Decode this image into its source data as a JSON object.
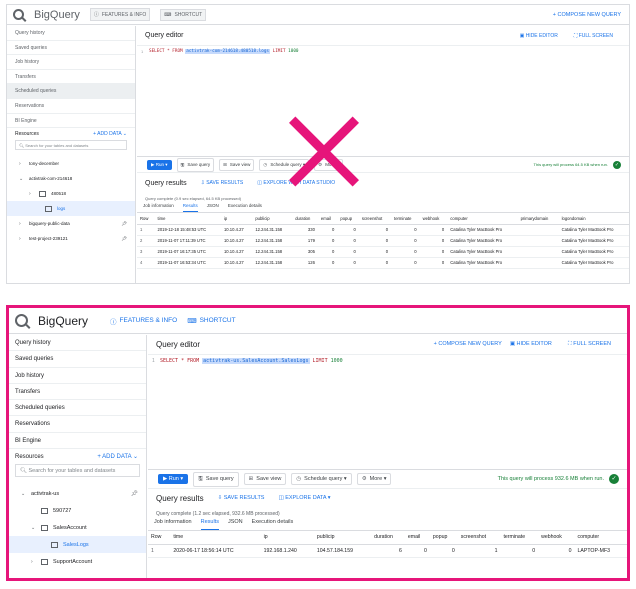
{
  "brand": "BigQuery",
  "header": {
    "features_label": "FEATURES & INFO",
    "shortcut_label": "SHORTCUT",
    "compose_label": "+ COMPOSE NEW QUERY"
  },
  "nav": [
    "Query history",
    "Saved queries",
    "Job history",
    "Transfers",
    "Scheduled queries",
    "Reservations",
    "BI Engine"
  ],
  "resources": {
    "label": "Resources",
    "add_label": "+ ADD DATA"
  },
  "search_placeholder": "Search for your tables and datasets",
  "editor": {
    "title": "Query editor",
    "hide_label": "HIDE EDITOR",
    "full_label": "FULL SCREEN",
    "line_no": "1",
    "kw_select": "SELECT * FROM",
    "kw_limit": "LIMIT",
    "limit_value": "1000"
  },
  "toolbar": {
    "run": "Run",
    "save_query": "Save query",
    "save_view": "Save view",
    "schedule": "Schedule query",
    "more": "More"
  },
  "results": {
    "title": "Query results",
    "save": "SAVE RESULTS",
    "explore": "EXPLORE WITH DATA STUDIO",
    "explore2": "EXPLORE DATA"
  },
  "tabs": [
    "Job information",
    "Results",
    "JSON",
    "Execution details"
  ],
  "top": {
    "table_name": "activtrak-com-214618.480518.logs",
    "validation": "This query will process 64.5 KB when run.",
    "complete": "Query complete (0.9 sec elapsed, 64.5 KB processed)",
    "tree": [
      {
        "label": "tony-december",
        "tw": "›"
      },
      {
        "label": "activtrak-com-214618",
        "tw": "⌄"
      },
      {
        "label": "480518",
        "tw": "›"
      },
      {
        "label": "logs",
        "tw": ""
      },
      {
        "label": "bigquery-public-data",
        "tw": "›"
      },
      {
        "label": "test-project-239121",
        "tw": "›"
      }
    ],
    "columns": [
      "Row",
      "time",
      "ip",
      "publicip",
      "duration",
      "email",
      "popup",
      "screenshot",
      "terminate",
      "webhook",
      "computer",
      "primarydomain",
      "logondomain"
    ],
    "rows": [
      [
        "1",
        "2019-12-18 15:48:53 UTC",
        "10.10.4.27",
        "12.244.31.158",
        "330",
        "0",
        "0",
        "0",
        "0",
        "0",
        "Catalina Tyler MacBook Pro",
        "",
        "Catalina Tyler MacBook Pro"
      ],
      [
        "2",
        "2019-11-07 17:11:39 UTC",
        "10.10.4.27",
        "12.244.31.158",
        "179",
        "0",
        "0",
        "0",
        "0",
        "0",
        "Catalina Tyler MacBook Pro",
        "",
        "Catalina Tyler MacBook Pro"
      ],
      [
        "3",
        "2019-11-07 16:17:35 UTC",
        "10.10.4.27",
        "12.244.31.158",
        "305",
        "0",
        "0",
        "0",
        "0",
        "0",
        "Catalina Tyler MacBook Pro",
        "",
        "Catalina Tyler MacBook Pro"
      ],
      [
        "4",
        "2019-11-07 16:53:34 UTC",
        "10.10.4.27",
        "12.244.31.158",
        "126",
        "0",
        "0",
        "0",
        "0",
        "0",
        "Catalina Tyler MacBook Pro",
        "",
        "Catalina Tyler MacBook Pro"
      ]
    ]
  },
  "bottom": {
    "table_name": "activtrak-us.SalesAccount.SalesLogs",
    "validation": "This query will process 932.6 MB when run.",
    "complete": "Query complete (1.2 sec elapsed, 932.6 MB processed)",
    "tree": [
      {
        "label": "activtrak-us",
        "tw": "⌄"
      },
      {
        "label": "590727",
        "tw": ""
      },
      {
        "label": "SalesAccount",
        "tw": "⌄"
      },
      {
        "label": "SalesLogs",
        "tw": ""
      },
      {
        "label": "SupportAccount",
        "tw": "›"
      }
    ],
    "columns": [
      "Row",
      "time",
      "ip",
      "publicip",
      "duration",
      "email",
      "popup",
      "screenshot",
      "terminate",
      "webhook",
      "computer"
    ],
    "rows": [
      [
        "1",
        "2020-06-17 18:56:14 UTC",
        "192.168.1.240",
        "104.57.184.159",
        "6",
        "0",
        "0",
        "1",
        "0",
        "0",
        "LAPTOP-MF3"
      ]
    ]
  },
  "colors": {
    "accent": "#1a73e8",
    "highlight": "#e6157a",
    "ok": "#188038"
  }
}
